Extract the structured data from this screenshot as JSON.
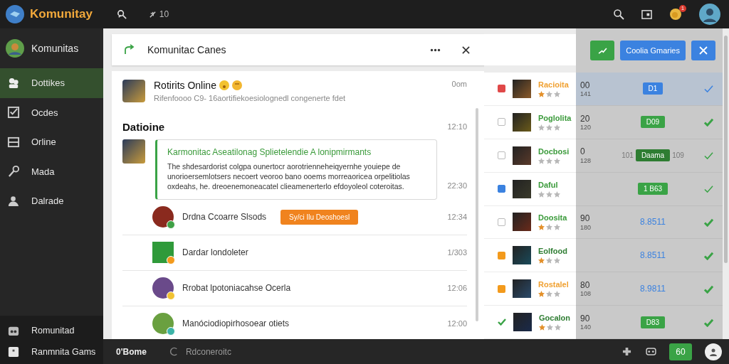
{
  "topbar": {
    "brand": "Komunitay",
    "count": "10",
    "notification_badge": "1"
  },
  "sidebar": {
    "header": "Komunitas",
    "items": [
      {
        "label": "Dottikes",
        "selected": true
      },
      {
        "label": "Ocdes",
        "selected": false
      },
      {
        "label": "Orline",
        "selected": false
      },
      {
        "label": "Mada",
        "selected": false
      },
      {
        "label": "Dalrade",
        "selected": false
      }
    ],
    "footer": [
      {
        "label": "Romunitad"
      },
      {
        "label": "Ranmnita Gams"
      }
    ]
  },
  "panel": {
    "title": "Komunitac Canes"
  },
  "conversation": {
    "top": {
      "title": "Rotirits Online",
      "subtitle": "Rifenfoooo  C9- 16aortifiekoesiolognedl congenerte fdet",
      "time": "0om"
    },
    "section": {
      "title": "Datioine",
      "time": "12:10"
    },
    "message": {
      "title": "Karmonitac Aseatilonag Splietelendie A lonipmirmants",
      "body": "The shdesardorist colgpa ounertocr aorotrienneheiqyernhe youiepe de unorioersemlotsers necoert veoroo bano ooems morreaoricea orpelitiolas oxdeahs, he. dreoenemoneacatel clieamenerterlo efdoyoleol coteroitas.",
      "time": "22:30"
    },
    "items": [
      {
        "name": "Drdna Ccoarre Slsods",
        "action": "Sy/ci Ilu Deoshoesl",
        "time": "12:34",
        "color": "#3fa046"
      },
      {
        "name": "Dardar londoleter",
        "time": "1/303",
        "color": "#f39a1c"
      },
      {
        "name": "Rrobat lpotoniacahse Ocerla",
        "time": "12:06",
        "color": "#f1c232"
      },
      {
        "name": "Manóciodiopirhosoear otiets",
        "time": "12:00",
        "color": "#3cb4a8"
      }
    ]
  },
  "actions": {
    "primary": "Coolia Gmaries"
  },
  "ranks": {
    "rows": [
      {
        "selected": true,
        "mark": {
          "kind": "flag",
          "color": "#e04848"
        },
        "name": "Racioita",
        "color": "#f0a030",
        "stars": 1,
        "score": "00",
        "sub": "141",
        "value": {
          "kind": "badge",
          "text": "D1",
          "color": "#3b82e0"
        },
        "check": {
          "kind": "outline",
          "color": "#3b82e0"
        }
      },
      {
        "selected": false,
        "mark": {
          "kind": "checkbox",
          "checked": false
        },
        "name": "Poglolita",
        "color": "#3a9a3a",
        "stars": 0,
        "score": "20",
        "sub": "120",
        "value": {
          "kind": "badge",
          "text": "D09",
          "color": "#3aa346"
        },
        "check": {
          "kind": "solid",
          "color": "#3aa346"
        }
      },
      {
        "selected": false,
        "mark": {
          "kind": "checkbox",
          "checked": false
        },
        "name": "Docbosi",
        "color": "#3a9a3a",
        "stars": 0,
        "score": "0",
        "sub": "128",
        "value": {
          "kind": "badge",
          "text": "Daama",
          "color": "#2e7d32",
          "before": "101",
          "after": "109"
        },
        "check": {
          "kind": "outline",
          "color": "#3aa346"
        }
      },
      {
        "selected": false,
        "mark": {
          "kind": "checkbox",
          "checked": true
        },
        "name": "Daful",
        "color": "#3a9a3a",
        "stars": 0,
        "value": {
          "kind": "badge",
          "text": "1 B63",
          "color": "#3aa346"
        },
        "check": {
          "kind": "outline",
          "color": "#3aa346"
        }
      },
      {
        "selected": false,
        "mark": {
          "kind": "checkbox",
          "checked": false
        },
        "name": "Doosita",
        "color": "#3a9a3a",
        "stars": 1,
        "score": "90",
        "sub": "180",
        "value": {
          "kind": "text",
          "text": "8.8511",
          "color": "#3b82e0"
        },
        "check": {
          "kind": "solid",
          "color": "#3aa346"
        }
      },
      {
        "selected": false,
        "mark": {
          "kind": "flag",
          "color": "#f39a1c"
        },
        "name": "Eolfood",
        "color": "#2e7d32",
        "stars": 1,
        "value": {
          "kind": "text",
          "text": "8.8511",
          "color": "#3b82e0"
        },
        "check": {
          "kind": "solid",
          "color": "#3aa346"
        }
      },
      {
        "selected": false,
        "mark": {
          "kind": "flag",
          "color": "#f39a1c"
        },
        "name": "Rostalel",
        "color": "#f0a030",
        "stars": 1,
        "score": "80",
        "sub": "108",
        "value": {
          "kind": "text",
          "text": "8.9811",
          "color": "#3b82e0"
        },
        "check": {
          "kind": "solid",
          "color": "#3aa346"
        }
      },
      {
        "selected": false,
        "mark": {
          "kind": "tick",
          "color": "#3aa346"
        },
        "name": "Gocalon",
        "color": "#2e7d32",
        "stars": 1,
        "score": "90",
        "sub": "140",
        "value": {
          "kind": "badge",
          "text": "D83",
          "color": "#3aa346"
        },
        "check": {
          "kind": "solid",
          "color": "#3aa346"
        }
      }
    ]
  },
  "bottom_bar": {
    "home": "0'Bome",
    "reconnect": "Rdconeroitc",
    "count": "60"
  }
}
